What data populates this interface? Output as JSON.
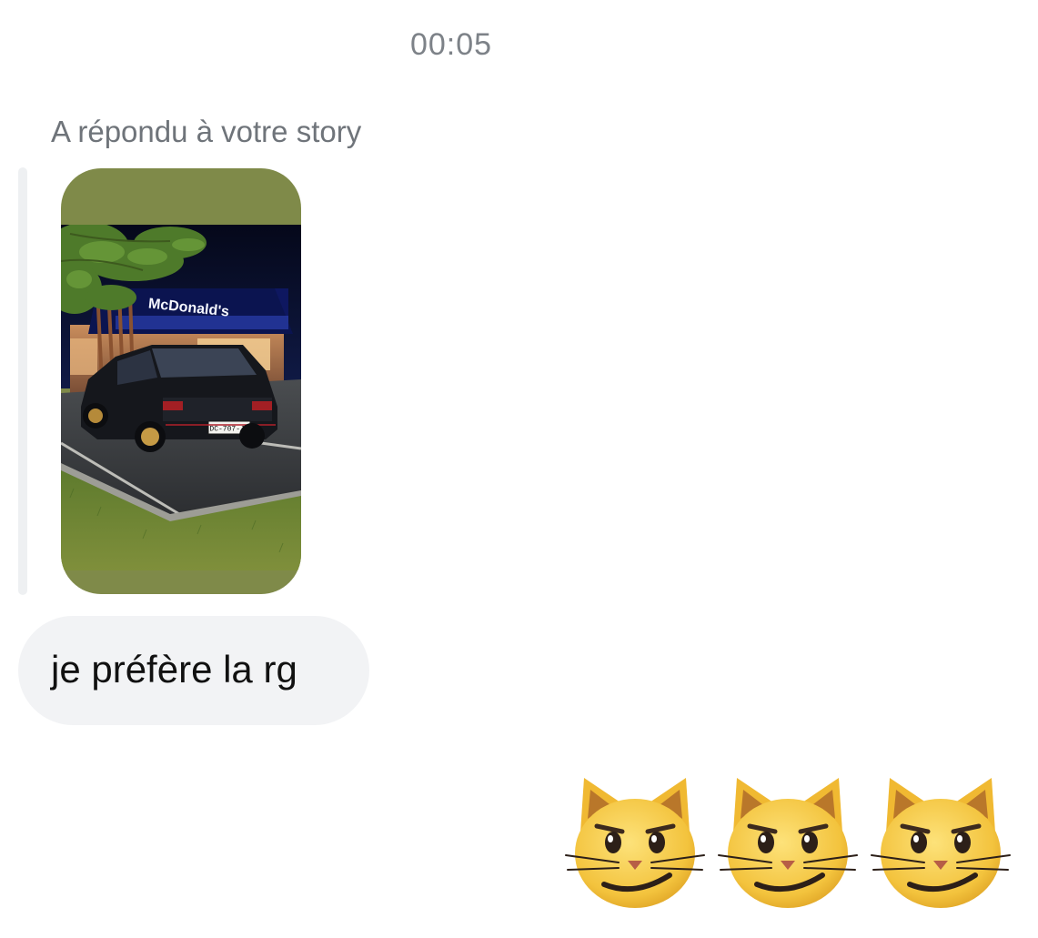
{
  "thread": {
    "timestamp": "00:05",
    "story_reply_label": "A répondu à votre story"
  },
  "story_preview": {
    "sign_text": "McDonald's",
    "plate_text": "DC-707-JA",
    "background_color": "#7f8a49"
  },
  "message": {
    "text": "je préfère la rg"
  },
  "reaction": {
    "icon": "smirking-cat-emoji",
    "count": 3
  }
}
